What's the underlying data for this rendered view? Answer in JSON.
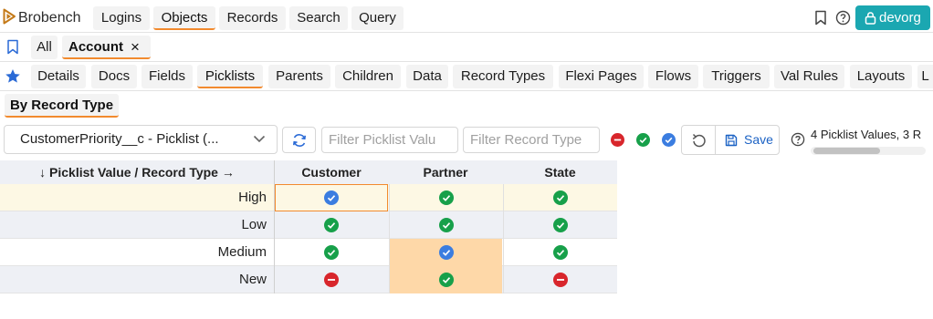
{
  "app": {
    "brand": "Brobench",
    "nav_tabs": [
      "Logins",
      "Objects",
      "Records",
      "Search",
      "Query"
    ],
    "active_nav": "Objects",
    "org_button": "devorg"
  },
  "object_tabs": {
    "all_label": "All",
    "open_tab": "Account",
    "close_glyph": "×"
  },
  "sub_tabs": {
    "items": [
      "Details",
      "Docs",
      "Fields",
      "Picklists",
      "Parents",
      "Children",
      "Data",
      "Record Types",
      "Flexi Pages",
      "Flows",
      "Triggers",
      "Val Rules",
      "Layouts",
      "L"
    ],
    "active": "Picklists"
  },
  "view_tabs": {
    "items": [
      "By Record Type"
    ],
    "active": "By Record Type"
  },
  "toolbar": {
    "picklist_selected": "CustomerPriority__c - Picklist (...",
    "filter_picklist_placeholder": "Filter Picklist Valu",
    "filter_record_placeholder": "Filter Record Type",
    "save_label": "Save",
    "summary": "4 Picklist Values, 3 R",
    "summary_scroll_fraction": 0.58
  },
  "colors": {
    "accent": "#f28a2e",
    "teal": "#1ba7b1",
    "active": "#17a04a",
    "default": "#3b7de0",
    "inactive": "#d8262c",
    "highlight_row": "#fdf8e4",
    "changed_cell": "#fed8a8"
  },
  "table": {
    "corner_header": "↓ Picklist Value / Record Type →",
    "columns": [
      "Customer",
      "Partner",
      "State"
    ],
    "rows": [
      {
        "value": "High",
        "cells": [
          "default",
          "active",
          "active"
        ]
      },
      {
        "value": "Low",
        "cells": [
          "active",
          "active",
          "active"
        ]
      },
      {
        "value": "Medium",
        "cells": [
          "active",
          "default",
          "active"
        ]
      },
      {
        "value": "New",
        "cells": [
          "inactive",
          "active",
          "inactive"
        ]
      }
    ]
  }
}
